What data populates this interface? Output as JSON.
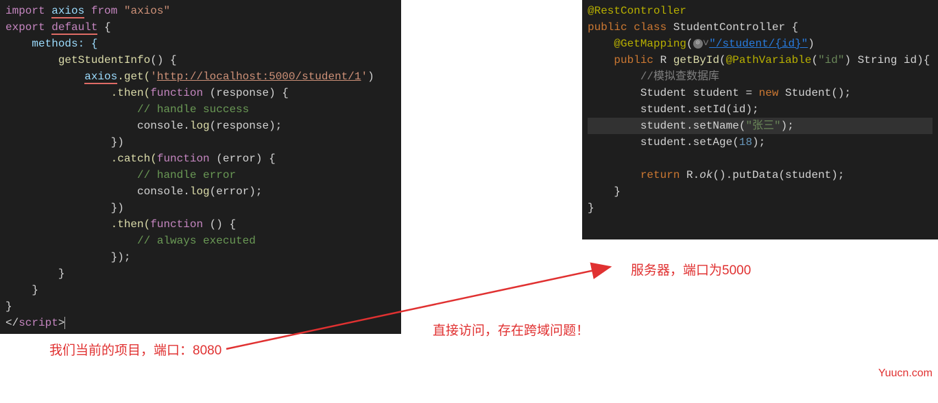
{
  "left": {
    "l1_import": "import",
    "l1_axios": "axios",
    "l1_from": "from",
    "l1_str": "\"axios\"",
    "l2_export": "export",
    "l2_default": "default",
    "l2_brace": " {",
    "l3": "    methods: {",
    "l4_fn": "getStudentInfo",
    "l4_rest": "() {",
    "l5_axios": "axios",
    "l5_get": ".get(",
    "l5_q1": "'",
    "l5_url": "http://localhost:5000/student/1",
    "l5_q2": "'",
    "l5_close": ")",
    "l6_then": ".then(",
    "l6_fn": "function",
    "l6_rest": " (response) {",
    "l7": "                    // handle success",
    "l8_a": "                    console.",
    "l8_log": "log",
    "l8_b": "(response);",
    "l9": "                })",
    "l10_catch": ".catch(",
    "l10_fn": "function",
    "l10_rest": " (error) {",
    "l11": "                    // handle error",
    "l12_a": "                    console.",
    "l12_log": "log",
    "l12_b": "(error);",
    "l13": "                })",
    "l14_then": ".then(",
    "l14_fn": "function",
    "l14_rest": " () {",
    "l15": "                    // always executed",
    "l16": "                });",
    "l17": "        }",
    "l18": "    }",
    "l19": "}",
    "l20_a": "</",
    "l20_b": "script",
    "l20_c": ">"
  },
  "right": {
    "r1": "@RestController",
    "r2_public": "public ",
    "r2_class": "class ",
    "r2_name": "StudentController {",
    "r3_anno": "@GetMapping",
    "r3_open": "(",
    "r3_link": "\"/student/{id}\"",
    "r3_close": ")",
    "r4_public": "public ",
    "r4_R": "R ",
    "r4_fn": "getById",
    "r4_open": "(",
    "r4_pv": "@PathVariable",
    "r4_pvopen": "(",
    "r4_pvstr": "\"id\"",
    "r4_pvclose": ") ",
    "r4_type": "String id){",
    "r5": "        //模拟查数据库",
    "r6_a": "        Student student = ",
    "r6_new": "new ",
    "r6_b": "Student();",
    "r7": "        student.setId(id);",
    "r8_a": "        student.setName(",
    "r8_str": "\"张三\"",
    "r8_b": ");",
    "r9_a": "        student.setAge(",
    "r9_num": "18",
    "r9_b": ");",
    "r10": "",
    "r11_a": "        return ",
    "r11_ok": "R.",
    "r11_okfn": "ok",
    "r11_b": "().putData(student);",
    "r12": "    }",
    "r13": "}"
  },
  "annotations": {
    "left": "我们当前的项目，端口：8080",
    "right": "服务器，端口为5000",
    "middle": "直接访问，存在跨域问题！",
    "watermark": "Yuucn.com"
  }
}
